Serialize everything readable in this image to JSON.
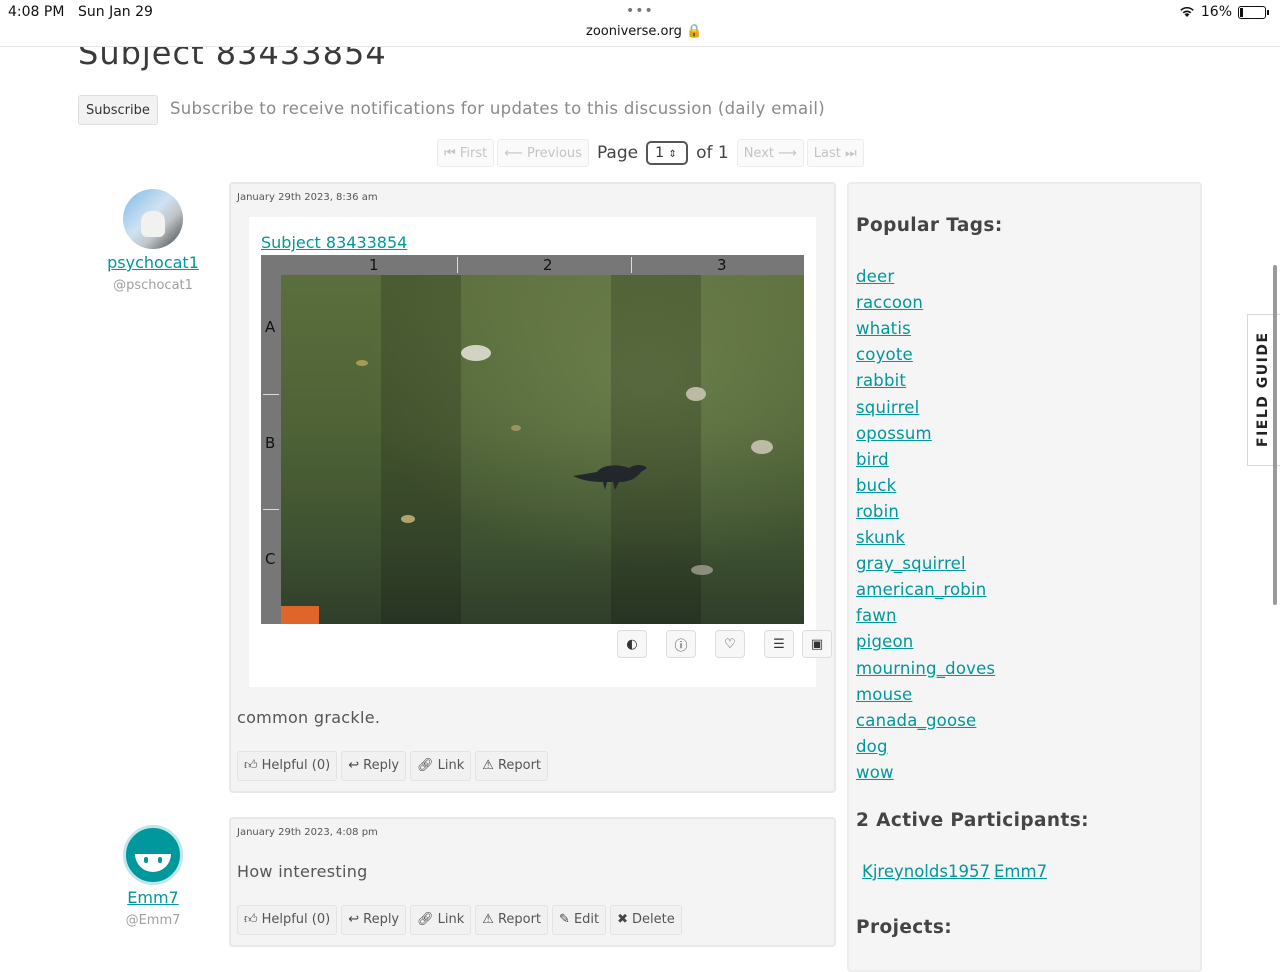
{
  "status_bar": {
    "time": "4:08 PM",
    "date": "Sun Jan 29",
    "dots": "•••",
    "url": "zooniverse.org",
    "battery": "16%"
  },
  "page": {
    "title": "Subject 83433854",
    "subscribe_label": "Subscribe",
    "subscribe_text": "Subscribe to receive notifications for updates to this discussion (daily email)"
  },
  "pager": {
    "first": "First",
    "previous": "Previous",
    "page_label": "Page",
    "page_value": "1",
    "of_label": "of 1",
    "next": "Next",
    "last": "Last"
  },
  "posts": [
    {
      "user_name": "psychocat1",
      "user_handle": "@pschocat1",
      "date": "January 29th 2023, 8:36 am",
      "subject_link": "Subject 83433854",
      "grid": {
        "cols": [
          "1",
          "2",
          "3"
        ],
        "rows": [
          "A",
          "B",
          "C"
        ]
      },
      "comment": "common grackle.",
      "actions": [
        "Helpful (0)",
        "Reply",
        "Link",
        "Report"
      ]
    },
    {
      "user_name": "Emm7",
      "user_handle": "@Emm7",
      "date": "January 29th 2023, 4:08 pm",
      "comment": "How interesting",
      "actions": [
        "Helpful (0)",
        "Reply",
        "Link",
        "Report",
        "Edit",
        "Delete"
      ]
    }
  ],
  "sidebar": {
    "tags_heading": "Popular Tags:",
    "tags": [
      "deer",
      "raccoon",
      "whatis",
      "coyote",
      "rabbit",
      "squirrel",
      "opossum",
      "bird",
      "buck",
      "robin",
      "skunk",
      "gray_squirrel",
      "american_robin",
      "fawn",
      "pigeon",
      "mourning_doves",
      "mouse",
      "canada_goose",
      "dog",
      "wow"
    ],
    "participants_heading": "2 Active Participants:",
    "participants": [
      "Kjreynolds1957",
      "Emm7"
    ],
    "projects_heading": "Projects:"
  },
  "field_guide_label": "FIELD GUIDE",
  "colors": {
    "link": "#00979d",
    "avatar2": "#00979d",
    "camera_badge": "#e0652a"
  }
}
